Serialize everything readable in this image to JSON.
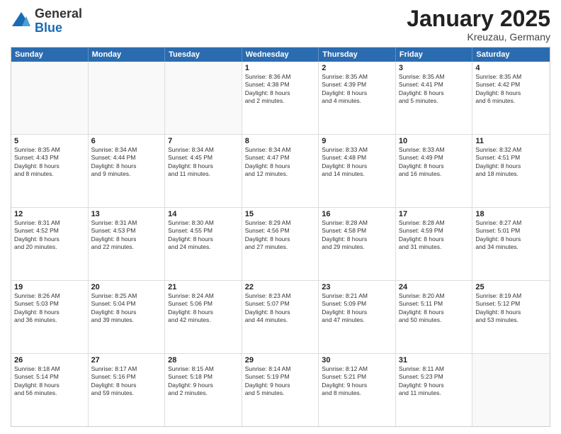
{
  "logo": {
    "general": "General",
    "blue": "Blue"
  },
  "header": {
    "title": "January 2025",
    "subtitle": "Kreuzau, Germany"
  },
  "days": [
    "Sunday",
    "Monday",
    "Tuesday",
    "Wednesday",
    "Thursday",
    "Friday",
    "Saturday"
  ],
  "weeks": [
    [
      {
        "day": "",
        "empty": true
      },
      {
        "day": "",
        "empty": true
      },
      {
        "day": "",
        "empty": true
      },
      {
        "day": "1",
        "lines": [
          "Sunrise: 8:36 AM",
          "Sunset: 4:38 PM",
          "Daylight: 8 hours",
          "and 2 minutes."
        ]
      },
      {
        "day": "2",
        "lines": [
          "Sunrise: 8:35 AM",
          "Sunset: 4:39 PM",
          "Daylight: 8 hours",
          "and 4 minutes."
        ]
      },
      {
        "day": "3",
        "lines": [
          "Sunrise: 8:35 AM",
          "Sunset: 4:41 PM",
          "Daylight: 8 hours",
          "and 5 minutes."
        ]
      },
      {
        "day": "4",
        "lines": [
          "Sunrise: 8:35 AM",
          "Sunset: 4:42 PM",
          "Daylight: 8 hours",
          "and 6 minutes."
        ]
      }
    ],
    [
      {
        "day": "5",
        "lines": [
          "Sunrise: 8:35 AM",
          "Sunset: 4:43 PM",
          "Daylight: 8 hours",
          "and 8 minutes."
        ]
      },
      {
        "day": "6",
        "lines": [
          "Sunrise: 8:34 AM",
          "Sunset: 4:44 PM",
          "Daylight: 8 hours",
          "and 9 minutes."
        ]
      },
      {
        "day": "7",
        "lines": [
          "Sunrise: 8:34 AM",
          "Sunset: 4:45 PM",
          "Daylight: 8 hours",
          "and 11 minutes."
        ]
      },
      {
        "day": "8",
        "lines": [
          "Sunrise: 8:34 AM",
          "Sunset: 4:47 PM",
          "Daylight: 8 hours",
          "and 12 minutes."
        ]
      },
      {
        "day": "9",
        "lines": [
          "Sunrise: 8:33 AM",
          "Sunset: 4:48 PM",
          "Daylight: 8 hours",
          "and 14 minutes."
        ]
      },
      {
        "day": "10",
        "lines": [
          "Sunrise: 8:33 AM",
          "Sunset: 4:49 PM",
          "Daylight: 8 hours",
          "and 16 minutes."
        ]
      },
      {
        "day": "11",
        "lines": [
          "Sunrise: 8:32 AM",
          "Sunset: 4:51 PM",
          "Daylight: 8 hours",
          "and 18 minutes."
        ]
      }
    ],
    [
      {
        "day": "12",
        "lines": [
          "Sunrise: 8:31 AM",
          "Sunset: 4:52 PM",
          "Daylight: 8 hours",
          "and 20 minutes."
        ]
      },
      {
        "day": "13",
        "lines": [
          "Sunrise: 8:31 AM",
          "Sunset: 4:53 PM",
          "Daylight: 8 hours",
          "and 22 minutes."
        ]
      },
      {
        "day": "14",
        "lines": [
          "Sunrise: 8:30 AM",
          "Sunset: 4:55 PM",
          "Daylight: 8 hours",
          "and 24 minutes."
        ]
      },
      {
        "day": "15",
        "lines": [
          "Sunrise: 8:29 AM",
          "Sunset: 4:56 PM",
          "Daylight: 8 hours",
          "and 27 minutes."
        ]
      },
      {
        "day": "16",
        "lines": [
          "Sunrise: 8:28 AM",
          "Sunset: 4:58 PM",
          "Daylight: 8 hours",
          "and 29 minutes."
        ]
      },
      {
        "day": "17",
        "lines": [
          "Sunrise: 8:28 AM",
          "Sunset: 4:59 PM",
          "Daylight: 8 hours",
          "and 31 minutes."
        ]
      },
      {
        "day": "18",
        "lines": [
          "Sunrise: 8:27 AM",
          "Sunset: 5:01 PM",
          "Daylight: 8 hours",
          "and 34 minutes."
        ]
      }
    ],
    [
      {
        "day": "19",
        "lines": [
          "Sunrise: 8:26 AM",
          "Sunset: 5:03 PM",
          "Daylight: 8 hours",
          "and 36 minutes."
        ]
      },
      {
        "day": "20",
        "lines": [
          "Sunrise: 8:25 AM",
          "Sunset: 5:04 PM",
          "Daylight: 8 hours",
          "and 39 minutes."
        ]
      },
      {
        "day": "21",
        "lines": [
          "Sunrise: 8:24 AM",
          "Sunset: 5:06 PM",
          "Daylight: 8 hours",
          "and 42 minutes."
        ]
      },
      {
        "day": "22",
        "lines": [
          "Sunrise: 8:23 AM",
          "Sunset: 5:07 PM",
          "Daylight: 8 hours",
          "and 44 minutes."
        ]
      },
      {
        "day": "23",
        "lines": [
          "Sunrise: 8:21 AM",
          "Sunset: 5:09 PM",
          "Daylight: 8 hours",
          "and 47 minutes."
        ]
      },
      {
        "day": "24",
        "lines": [
          "Sunrise: 8:20 AM",
          "Sunset: 5:11 PM",
          "Daylight: 8 hours",
          "and 50 minutes."
        ]
      },
      {
        "day": "25",
        "lines": [
          "Sunrise: 8:19 AM",
          "Sunset: 5:12 PM",
          "Daylight: 8 hours",
          "and 53 minutes."
        ]
      }
    ],
    [
      {
        "day": "26",
        "lines": [
          "Sunrise: 8:18 AM",
          "Sunset: 5:14 PM",
          "Daylight: 8 hours",
          "and 56 minutes."
        ]
      },
      {
        "day": "27",
        "lines": [
          "Sunrise: 8:17 AM",
          "Sunset: 5:16 PM",
          "Daylight: 8 hours",
          "and 59 minutes."
        ]
      },
      {
        "day": "28",
        "lines": [
          "Sunrise: 8:15 AM",
          "Sunset: 5:18 PM",
          "Daylight: 9 hours",
          "and 2 minutes."
        ]
      },
      {
        "day": "29",
        "lines": [
          "Sunrise: 8:14 AM",
          "Sunset: 5:19 PM",
          "Daylight: 9 hours",
          "and 5 minutes."
        ]
      },
      {
        "day": "30",
        "lines": [
          "Sunrise: 8:12 AM",
          "Sunset: 5:21 PM",
          "Daylight: 9 hours",
          "and 8 minutes."
        ]
      },
      {
        "day": "31",
        "lines": [
          "Sunrise: 8:11 AM",
          "Sunset: 5:23 PM",
          "Daylight: 9 hours",
          "and 11 minutes."
        ]
      },
      {
        "day": "",
        "empty": true
      }
    ]
  ]
}
